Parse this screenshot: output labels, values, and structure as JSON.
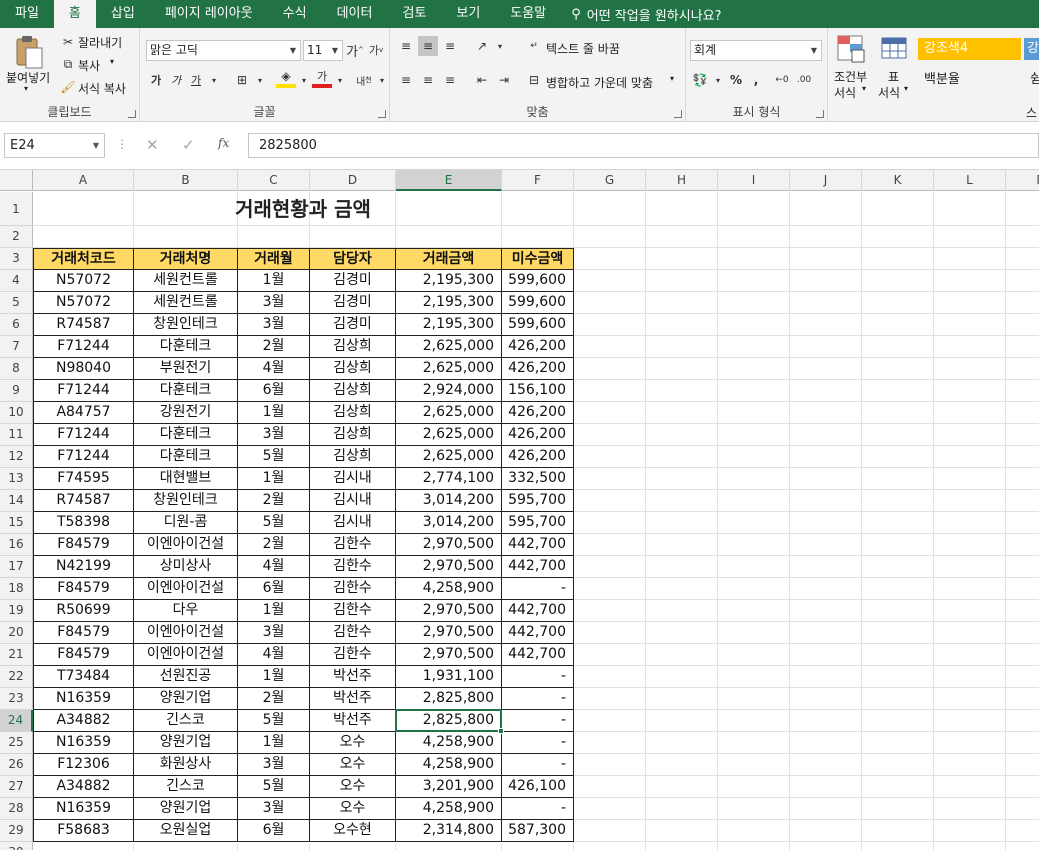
{
  "tabs": [
    "파일",
    "홈",
    "삽입",
    "페이지 레이아웃",
    "수식",
    "데이터",
    "검토",
    "보기",
    "도움말"
  ],
  "tell_me": "어떤 작업을 원하시나요?",
  "ribbon": {
    "paste": "붙여넣기",
    "cut": "잘라내기",
    "copy": "복사",
    "format_painter": "서식 복사",
    "clipboard": "클립보드",
    "font_name": "맑은 고딕",
    "font_size": "11",
    "font": "글꼴",
    "wrap_text": "텍스트 줄 바꿈",
    "merge_center": "병합하고 가운데 맞춤",
    "alignment": "맞춤",
    "number_format": "회계",
    "number": "표시 형식",
    "conditional": "조건부",
    "conditional2": "서식",
    "table_format": "표",
    "table_format2": "서식",
    "style1": "강조색4",
    "style1_next": "강",
    "style2": "백분율",
    "style2_next": "쉼",
    "styles": "스"
  },
  "formula_bar": {
    "name_box": "E24",
    "formula": "2825800"
  },
  "columns": [
    "A",
    "B",
    "C",
    "D",
    "E",
    "F",
    "G",
    "H",
    "I",
    "J",
    "K",
    "L",
    "M"
  ],
  "sheet": {
    "title": "거래현황과 금액",
    "headers": [
      "거래처코드",
      "거래처명",
      "거래월",
      "담당자",
      "거래금액",
      "미수금액"
    ],
    "rows": [
      [
        "N57072",
        "세원컨트롤",
        "1월",
        "김경미",
        "2,195,300",
        "599,600"
      ],
      [
        "N57072",
        "세원컨트롤",
        "3월",
        "김경미",
        "2,195,300",
        "599,600"
      ],
      [
        "R74587",
        "창원인테크",
        "3월",
        "김경미",
        "2,195,300",
        "599,600"
      ],
      [
        "F71244",
        "다훈테크",
        "2월",
        "김상희",
        "2,625,000",
        "426,200"
      ],
      [
        "N98040",
        "부원전기",
        "4월",
        "김상희",
        "2,625,000",
        "426,200"
      ],
      [
        "F71244",
        "다훈테크",
        "6월",
        "김상희",
        "2,924,000",
        "156,100"
      ],
      [
        "A84757",
        "강원전기",
        "1월",
        "김상희",
        "2,625,000",
        "426,200"
      ],
      [
        "F71244",
        "다훈테크",
        "3월",
        "김상희",
        "2,625,000",
        "426,200"
      ],
      [
        "F71244",
        "다훈테크",
        "5월",
        "김상희",
        "2,625,000",
        "426,200"
      ],
      [
        "F74595",
        "대현밸브",
        "1월",
        "김시내",
        "2,774,100",
        "332,500"
      ],
      [
        "R74587",
        "창원인테크",
        "2월",
        "김시내",
        "3,014,200",
        "595,700"
      ],
      [
        "T58398",
        "디원-콤",
        "5월",
        "김시내",
        "3,014,200",
        "595,700"
      ],
      [
        "F84579",
        "이엔아이건설",
        "2월",
        "김한수",
        "2,970,500",
        "442,700"
      ],
      [
        "N42199",
        "상미상사",
        "4월",
        "김한수",
        "2,970,500",
        "442,700"
      ],
      [
        "F84579",
        "이엔아이건설",
        "6월",
        "김한수",
        "4,258,900",
        "-"
      ],
      [
        "R50699",
        "다우",
        "1월",
        "김한수",
        "2,970,500",
        "442,700"
      ],
      [
        "F84579",
        "이엔아이건설",
        "3월",
        "김한수",
        "2,970,500",
        "442,700"
      ],
      [
        "F84579",
        "이엔아이건설",
        "4월",
        "김한수",
        "2,970,500",
        "442,700"
      ],
      [
        "T73484",
        "선원진공",
        "1월",
        "박선주",
        "1,931,100",
        "-"
      ],
      [
        "N16359",
        "양원기업",
        "2월",
        "박선주",
        "2,825,800",
        "-"
      ],
      [
        "A34882",
        "긴스코",
        "5월",
        "박선주",
        "2,825,800",
        "-"
      ],
      [
        "N16359",
        "양원기업",
        "1월",
        "오수",
        "4,258,900",
        "-"
      ],
      [
        "F12306",
        "화원상사",
        "3월",
        "오수",
        "4,258,900",
        "-"
      ],
      [
        "A34882",
        "긴스코",
        "5월",
        "오수",
        "3,201,900",
        "426,100"
      ],
      [
        "N16359",
        "양원기업",
        "3월",
        "오수",
        "4,258,900",
        "-"
      ],
      [
        "F58683",
        "오원실업",
        "6월",
        "오수현",
        "2,314,800",
        "587,300"
      ]
    ]
  }
}
